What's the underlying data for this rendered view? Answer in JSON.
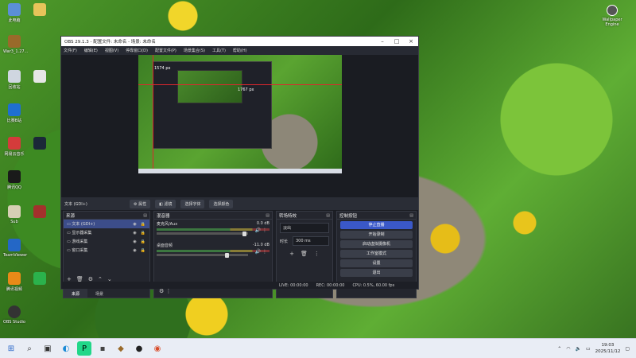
{
  "desktop": {
    "icons": [
      {
        "label": "此电脑",
        "color": "#5b8fd6"
      },
      {
        "label": "War3_1.27...",
        "color": "#9a6a2a"
      },
      {
        "label": "回收站",
        "color": "#cfd6e0"
      },
      {
        "label": "比赛B站",
        "color": "#1f6fd0"
      },
      {
        "label": "网易云音乐",
        "color": "#d43b3b"
      },
      {
        "label": "腾讯QQ",
        "color": "#1a1a1a"
      },
      {
        "label": "Sub",
        "color": "#d6cfb4"
      },
      {
        "label": "TeamViewer",
        "color": "#2467c6"
      },
      {
        "label": "腾讯视频",
        "color": "#e88a18"
      },
      {
        "label": "OBS Studio",
        "color": "#333333"
      }
    ],
    "right_icon_label": "Wallpaper Engine"
  },
  "obs": {
    "title": "OBS 29.1.3 - 配置文件: 未命名 - 场景: 未命名",
    "menu": [
      "文件(F)",
      "编辑(E)",
      "视图(V)",
      "停靠窗口(D)",
      "配置文件(P)",
      "场景集合(S)",
      "工具(T)",
      "帮助(H)"
    ],
    "preview": {
      "px_label_1": "1574 px",
      "px_label_2": "1767 px"
    },
    "source_bar": {
      "selected_source": "文本 (GDI+)",
      "properties": "属性",
      "filters": "滤镜",
      "select_font": "选择字体",
      "select_color": "选择颜色"
    },
    "scenes_dock": {
      "title": "来源",
      "items": [
        {
          "label": "文本 (GDI+)",
          "selected": true
        },
        {
          "label": "显示器采集",
          "selected": false
        },
        {
          "label": "游戏采集",
          "selected": false
        },
        {
          "label": "窗口采集",
          "selected": false
        }
      ],
      "tabs": [
        "来源",
        "场景"
      ]
    },
    "mixer": {
      "title": "混音器",
      "channels": [
        {
          "name": "麦克风/Aux",
          "db": "0.0 dB",
          "level": 0.98
        },
        {
          "name": "桌面音频",
          "db": "-11.0 dB",
          "level": 0.78
        }
      ]
    },
    "transitions": {
      "title": "转场特效",
      "transition": "淡出",
      "duration_label": "时长",
      "duration": "300 ms"
    },
    "controls": {
      "title": "控制按钮",
      "buttons": [
        "停止直播",
        "开始录制",
        "启动虚拟摄像机",
        "工作室模式",
        "设置",
        "退出"
      ]
    },
    "status": {
      "live": "LIVE: 00:00:00",
      "rec": "REC: 00:00:00",
      "cpu": "CPU: 0.5%, 60.00 fps"
    }
  },
  "taskbar": {
    "time": "19:03",
    "date": "2025/11/12"
  }
}
